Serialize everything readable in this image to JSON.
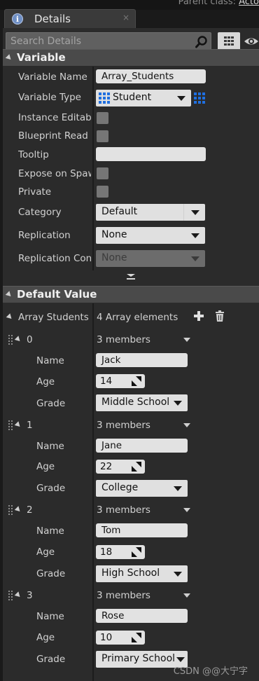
{
  "topbar": {
    "parent_label": "Parent class:",
    "parent_value": "Acto"
  },
  "tab": {
    "title": "Details",
    "icon": "info-icon",
    "close_glyph": "×"
  },
  "search": {
    "placeholder": "Search Details"
  },
  "sections": {
    "variable": "Variable",
    "default_value": "Default Value"
  },
  "variable": {
    "name_label": "Variable Name",
    "name_value": "Array_Students",
    "type_label": "Variable Type",
    "type_value": "Student",
    "instance_editable_label": "Instance Editab",
    "blueprint_readonly_label": "Blueprint Read (",
    "tooltip_label": "Tooltip",
    "tooltip_value": "",
    "expose_spawn_label": "Expose on Spaw",
    "private_label": "Private",
    "category_label": "Category",
    "category_value": "Default",
    "replication_label": "Replication",
    "replication_value": "None",
    "replication_condition_label": "Replication Con",
    "replication_condition_value": "None"
  },
  "array": {
    "label": "Array Students",
    "count_text": "4 Array elements",
    "elements": [
      {
        "index": "0",
        "members": "3 members",
        "name_label": "Name",
        "name": "Jack",
        "age_label": "Age",
        "age": "14",
        "grade_label": "Grade",
        "grade": "Middle School"
      },
      {
        "index": "1",
        "members": "3 members",
        "name_label": "Name",
        "name": "Jane",
        "age_label": "Age",
        "age": "22",
        "grade_label": "Grade",
        "grade": "College"
      },
      {
        "index": "2",
        "members": "3 members",
        "name_label": "Name",
        "name": "Tom",
        "age_label": "Age",
        "age": "18",
        "grade_label": "Grade",
        "grade": "High School"
      },
      {
        "index": "3",
        "members": "3 members",
        "name_label": "Name",
        "name": "Rose",
        "age_label": "Age",
        "age": "10",
        "grade_label": "Grade",
        "grade": "Primary School"
      }
    ]
  },
  "watermark": "CSDN @@大宁字",
  "colors": {
    "panel_bg": "#2b2b2b",
    "section_header": "#4a4a4a",
    "type_icon_blue": "#1f6fe0"
  }
}
